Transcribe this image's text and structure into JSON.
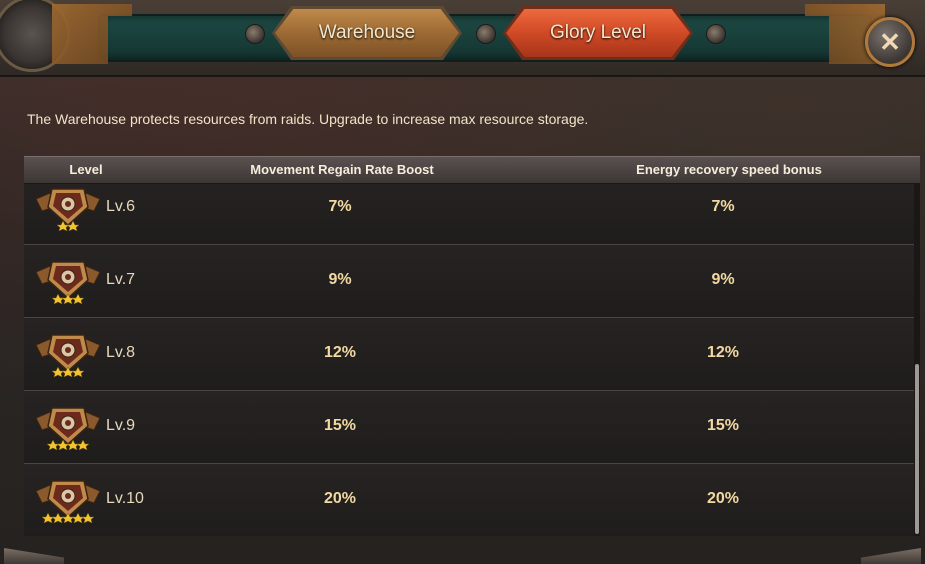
{
  "tabs": [
    {
      "label": "Warehouse",
      "active": false
    },
    {
      "label": "Glory Level",
      "active": true
    }
  ],
  "close_label": "✕",
  "description": "The Warehouse protects resources from raids. Upgrade to increase max resource storage.",
  "table": {
    "headers": {
      "level": "Level",
      "movement": "Movement Regain Rate Boost",
      "energy": "Energy recovery speed bonus"
    },
    "rows": [
      {
        "level": "Lv.6",
        "movement": "7%",
        "energy": "7%",
        "stars": 2
      },
      {
        "level": "Lv.7",
        "movement": "9%",
        "energy": "9%",
        "stars": 3
      },
      {
        "level": "Lv.8",
        "movement": "12%",
        "energy": "12%",
        "stars": 3
      },
      {
        "level": "Lv.9",
        "movement": "15%",
        "energy": "15%",
        "stars": 4
      },
      {
        "level": "Lv.10",
        "movement": "20%",
        "energy": "20%",
        "stars": 5
      }
    ]
  },
  "colors": {
    "value_text": "#f2d9a2",
    "active_tab": "#cf4a26",
    "inactive_tab": "#9c6a34",
    "header_strip": "#1e4b46"
  },
  "icons": {
    "close": "close-icon",
    "badge": "glory-badge-icon"
  },
  "scroll": {
    "position_fraction": 0.85
  }
}
